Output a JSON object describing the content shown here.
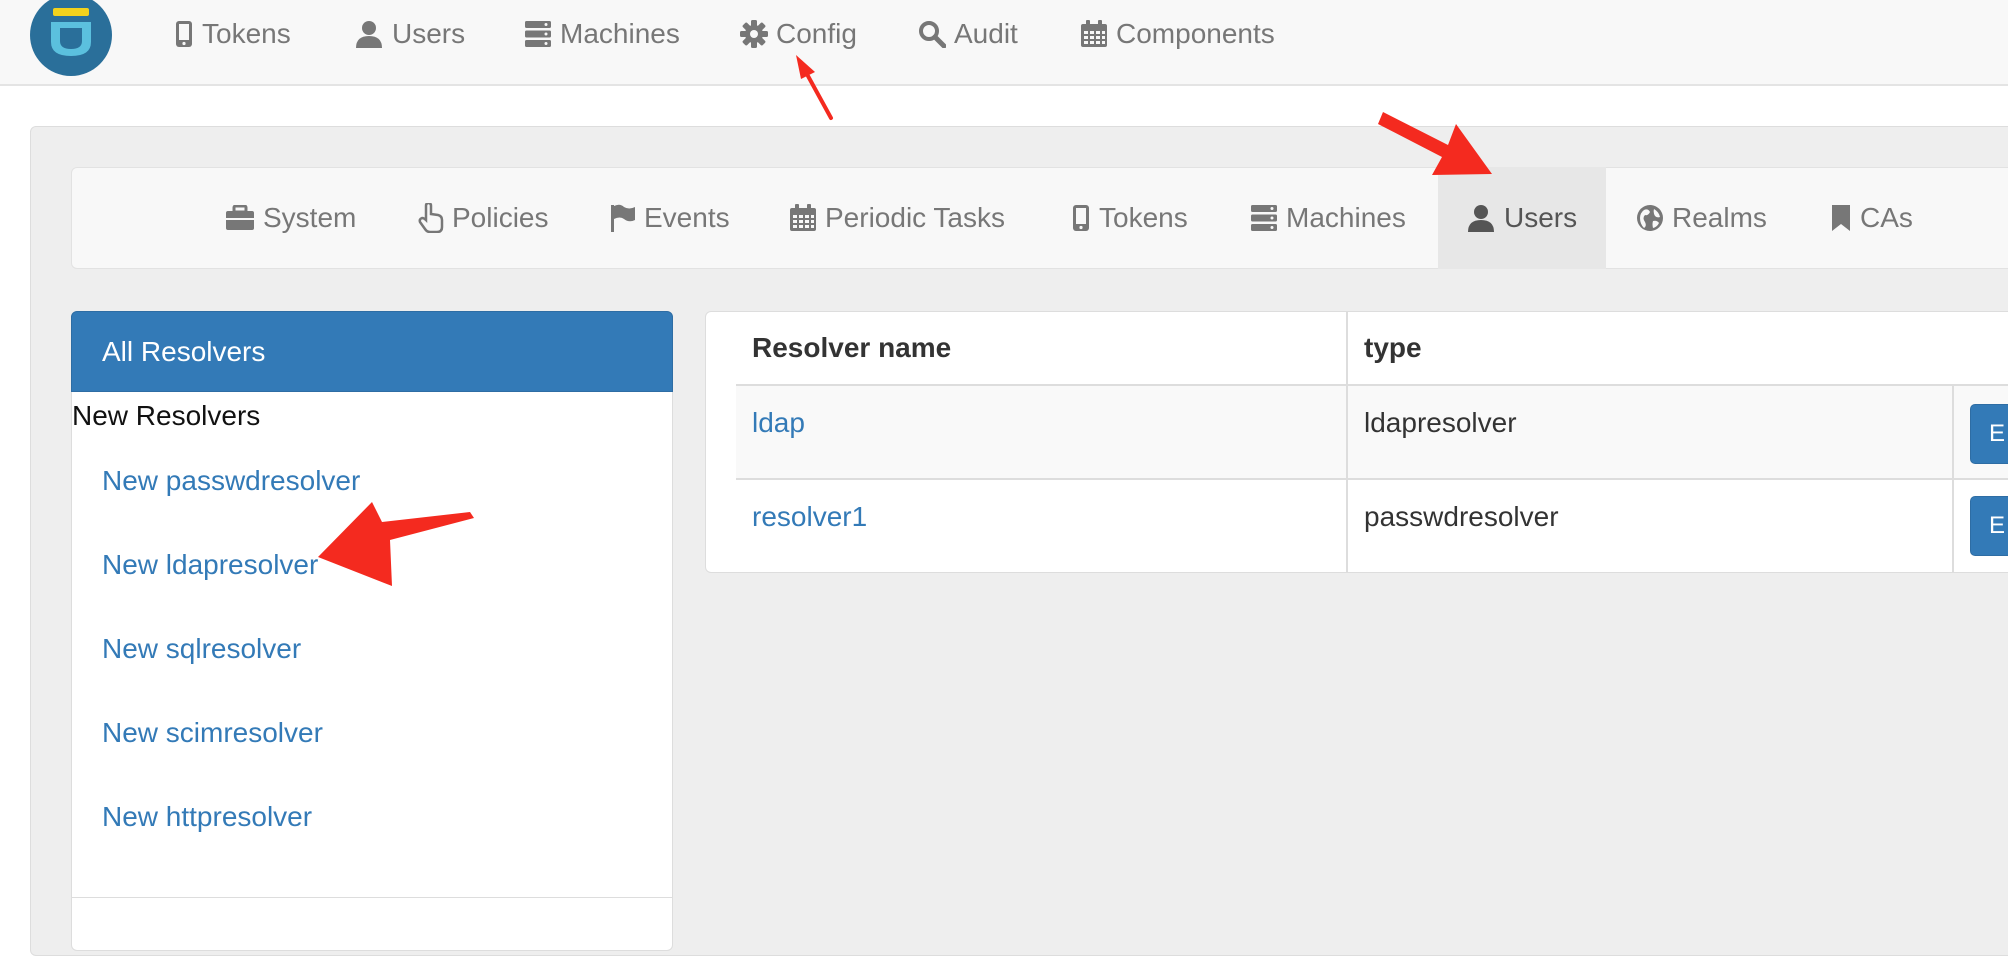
{
  "top_nav": {
    "items": [
      {
        "label": "Tokens",
        "icon": "mobile-icon"
      },
      {
        "label": "Users",
        "icon": "user-icon"
      },
      {
        "label": "Machines",
        "icon": "server-icon"
      },
      {
        "label": "Config",
        "icon": "gear-icon"
      },
      {
        "label": "Audit",
        "icon": "search-icon"
      },
      {
        "label": "Components",
        "icon": "calendar-icon"
      }
    ]
  },
  "config_nav": {
    "items": [
      {
        "label": "System",
        "icon": "briefcase-icon"
      },
      {
        "label": "Policies",
        "icon": "hand-pointer-icon"
      },
      {
        "label": "Events",
        "icon": "flag-icon"
      },
      {
        "label": "Periodic Tasks",
        "icon": "calendar-icon"
      },
      {
        "label": "Tokens",
        "icon": "mobile-icon"
      },
      {
        "label": "Machines",
        "icon": "server-icon"
      },
      {
        "label": "Users",
        "icon": "user-icon",
        "active": true
      },
      {
        "label": "Realms",
        "icon": "globe-icon"
      },
      {
        "label": "CAs",
        "icon": "bookmark-icon"
      }
    ]
  },
  "sidebar": {
    "active_label": "All Resolvers",
    "heading": "New Resolvers",
    "links": [
      "New passwdresolver",
      "New ldapresolver",
      "New sqlresolver",
      "New scimresolver",
      "New httpresolver"
    ]
  },
  "resolver_table": {
    "columns": [
      "Resolver name",
      "type"
    ],
    "rows": [
      {
        "name": "ldap",
        "type": "ldapresolver",
        "button": "E"
      },
      {
        "name": "resolver1",
        "type": "passwdresolver",
        "button": "E"
      }
    ]
  },
  "colors": {
    "primary": "#337ab7",
    "annotation_arrow": "#f42a1f",
    "nav_text": "#777777"
  }
}
